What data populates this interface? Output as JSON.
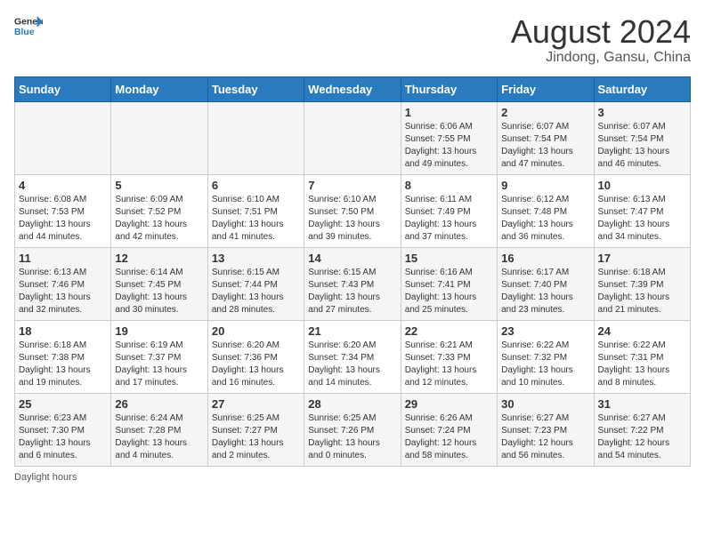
{
  "header": {
    "logo_line1": "General",
    "logo_line2": "Blue",
    "month_title": "August 2024",
    "location": "Jindong, Gansu, China",
    "legend": "Daylight hours"
  },
  "days_of_week": [
    "Sunday",
    "Monday",
    "Tuesday",
    "Wednesday",
    "Thursday",
    "Friday",
    "Saturday"
  ],
  "weeks": [
    [
      {
        "day": "",
        "info": ""
      },
      {
        "day": "",
        "info": ""
      },
      {
        "day": "",
        "info": ""
      },
      {
        "day": "",
        "info": ""
      },
      {
        "day": "1",
        "info": "Sunrise: 6:06 AM\nSunset: 7:55 PM\nDaylight: 13 hours and 49 minutes."
      },
      {
        "day": "2",
        "info": "Sunrise: 6:07 AM\nSunset: 7:54 PM\nDaylight: 13 hours and 47 minutes."
      },
      {
        "day": "3",
        "info": "Sunrise: 6:07 AM\nSunset: 7:54 PM\nDaylight: 13 hours and 46 minutes."
      }
    ],
    [
      {
        "day": "4",
        "info": "Sunrise: 6:08 AM\nSunset: 7:53 PM\nDaylight: 13 hours and 44 minutes."
      },
      {
        "day": "5",
        "info": "Sunrise: 6:09 AM\nSunset: 7:52 PM\nDaylight: 13 hours and 42 minutes."
      },
      {
        "day": "6",
        "info": "Sunrise: 6:10 AM\nSunset: 7:51 PM\nDaylight: 13 hours and 41 minutes."
      },
      {
        "day": "7",
        "info": "Sunrise: 6:10 AM\nSunset: 7:50 PM\nDaylight: 13 hours and 39 minutes."
      },
      {
        "day": "8",
        "info": "Sunrise: 6:11 AM\nSunset: 7:49 PM\nDaylight: 13 hours and 37 minutes."
      },
      {
        "day": "9",
        "info": "Sunrise: 6:12 AM\nSunset: 7:48 PM\nDaylight: 13 hours and 36 minutes."
      },
      {
        "day": "10",
        "info": "Sunrise: 6:13 AM\nSunset: 7:47 PM\nDaylight: 13 hours and 34 minutes."
      }
    ],
    [
      {
        "day": "11",
        "info": "Sunrise: 6:13 AM\nSunset: 7:46 PM\nDaylight: 13 hours and 32 minutes."
      },
      {
        "day": "12",
        "info": "Sunrise: 6:14 AM\nSunset: 7:45 PM\nDaylight: 13 hours and 30 minutes."
      },
      {
        "day": "13",
        "info": "Sunrise: 6:15 AM\nSunset: 7:44 PM\nDaylight: 13 hours and 28 minutes."
      },
      {
        "day": "14",
        "info": "Sunrise: 6:15 AM\nSunset: 7:43 PM\nDaylight: 13 hours and 27 minutes."
      },
      {
        "day": "15",
        "info": "Sunrise: 6:16 AM\nSunset: 7:41 PM\nDaylight: 13 hours and 25 minutes."
      },
      {
        "day": "16",
        "info": "Sunrise: 6:17 AM\nSunset: 7:40 PM\nDaylight: 13 hours and 23 minutes."
      },
      {
        "day": "17",
        "info": "Sunrise: 6:18 AM\nSunset: 7:39 PM\nDaylight: 13 hours and 21 minutes."
      }
    ],
    [
      {
        "day": "18",
        "info": "Sunrise: 6:18 AM\nSunset: 7:38 PM\nDaylight: 13 hours and 19 minutes."
      },
      {
        "day": "19",
        "info": "Sunrise: 6:19 AM\nSunset: 7:37 PM\nDaylight: 13 hours and 17 minutes."
      },
      {
        "day": "20",
        "info": "Sunrise: 6:20 AM\nSunset: 7:36 PM\nDaylight: 13 hours and 16 minutes."
      },
      {
        "day": "21",
        "info": "Sunrise: 6:20 AM\nSunset: 7:34 PM\nDaylight: 13 hours and 14 minutes."
      },
      {
        "day": "22",
        "info": "Sunrise: 6:21 AM\nSunset: 7:33 PM\nDaylight: 13 hours and 12 minutes."
      },
      {
        "day": "23",
        "info": "Sunrise: 6:22 AM\nSunset: 7:32 PM\nDaylight: 13 hours and 10 minutes."
      },
      {
        "day": "24",
        "info": "Sunrise: 6:22 AM\nSunset: 7:31 PM\nDaylight: 13 hours and 8 minutes."
      }
    ],
    [
      {
        "day": "25",
        "info": "Sunrise: 6:23 AM\nSunset: 7:30 PM\nDaylight: 13 hours and 6 minutes."
      },
      {
        "day": "26",
        "info": "Sunrise: 6:24 AM\nSunset: 7:28 PM\nDaylight: 13 hours and 4 minutes."
      },
      {
        "day": "27",
        "info": "Sunrise: 6:25 AM\nSunset: 7:27 PM\nDaylight: 13 hours and 2 minutes."
      },
      {
        "day": "28",
        "info": "Sunrise: 6:25 AM\nSunset: 7:26 PM\nDaylight: 13 hours and 0 minutes."
      },
      {
        "day": "29",
        "info": "Sunrise: 6:26 AM\nSunset: 7:24 PM\nDaylight: 12 hours and 58 minutes."
      },
      {
        "day": "30",
        "info": "Sunrise: 6:27 AM\nSunset: 7:23 PM\nDaylight: 12 hours and 56 minutes."
      },
      {
        "day": "31",
        "info": "Sunrise: 6:27 AM\nSunset: 7:22 PM\nDaylight: 12 hours and 54 minutes."
      }
    ]
  ]
}
